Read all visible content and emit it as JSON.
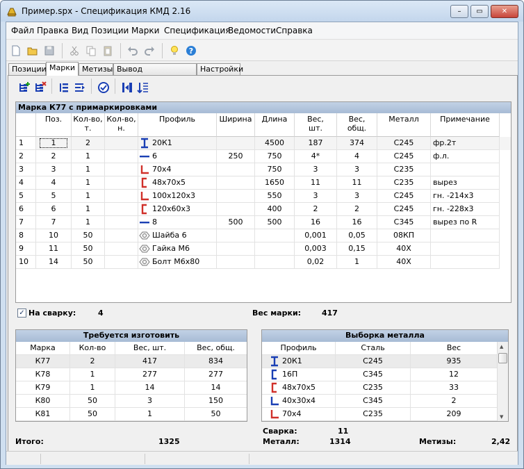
{
  "window": {
    "title": "Пример.spx - Спецификация КМД 2.16",
    "min": "–",
    "max": "▭",
    "close": "✕"
  },
  "menu": [
    "Файл",
    "Правка",
    "Вид",
    "Позиции",
    "Марки",
    "Спецификация",
    "Ведомости",
    "Справка"
  ],
  "tabs": [
    "Позиции",
    "Марки",
    "Метизы",
    "Вывод спецификации",
    "Настройки"
  ],
  "main_grid": {
    "caption": "Марка К77 с примаркировками",
    "headers": [
      "Поз.",
      "Кол-во,\nт.",
      "Кол-во,\nн.",
      "Профиль",
      "Ширина",
      "Длина",
      "Вес,\nшт.",
      "Вес,\nобщ.",
      "Металл",
      "Примечание"
    ],
    "rows": [
      {
        "n": "1",
        "pos": "1",
        "qt": "2",
        "qn": "",
        "prof": "20К1",
        "icon": "i-beam",
        "w": "",
        "len": "4500",
        "ws": "187",
        "wt": "374",
        "met": "С245",
        "note": "фр.2т"
      },
      {
        "n": "2",
        "pos": "2",
        "qt": "1",
        "qn": "",
        "prof": "6",
        "icon": "plate",
        "w": "250",
        "len": "750",
        "ws": "4*",
        "wt": "4",
        "met": "С245",
        "note": "ф.л."
      },
      {
        "n": "3",
        "pos": "3",
        "qt": "1",
        "qn": "",
        "prof": "70х4",
        "icon": "angle",
        "w": "",
        "len": "750",
        "ws": "3",
        "wt": "3",
        "met": "С235",
        "note": ""
      },
      {
        "n": "4",
        "pos": "4",
        "qt": "1",
        "qn": "",
        "prof": "48х70х5",
        "icon": "channel",
        "w": "",
        "len": "1650",
        "ws": "11",
        "wt": "11",
        "met": "С235",
        "note": "вырез"
      },
      {
        "n": "5",
        "pos": "5",
        "qt": "1",
        "qn": "",
        "prof": "100х120х3",
        "icon": "angle",
        "w": "",
        "len": "550",
        "ws": "3",
        "wt": "3",
        "met": "С245",
        "note": "гн. -214х3"
      },
      {
        "n": "6",
        "pos": "6",
        "qt": "1",
        "qn": "",
        "prof": "120х60х3",
        "icon": "channel",
        "w": "",
        "len": "400",
        "ws": "2",
        "wt": "2",
        "met": "С245",
        "note": "гн. -228х3"
      },
      {
        "n": "7",
        "pos": "7",
        "qt": "1",
        "qn": "",
        "prof": "8",
        "icon": "plate",
        "w": "500",
        "len": "500",
        "ws": "16",
        "wt": "16",
        "met": "С345",
        "note": "вырез по R"
      },
      {
        "n": "8",
        "pos": "10",
        "qt": "50",
        "qn": "",
        "prof": "Шайба 6",
        "icon": "hardware",
        "w": "",
        "len": "",
        "ws": "0,001",
        "wt": "0,05",
        "met": "08КП",
        "note": ""
      },
      {
        "n": "9",
        "pos": "11",
        "qt": "50",
        "qn": "",
        "prof": "Гайка М6",
        "icon": "hardware",
        "w": "",
        "len": "",
        "ws": "0,003",
        "wt": "0,15",
        "met": "40Х",
        "note": ""
      },
      {
        "n": "10",
        "pos": "14",
        "qt": "50",
        "qn": "",
        "prof": "Болт М6х80",
        "icon": "hardware",
        "w": "",
        "len": "",
        "ws": "0,02",
        "wt": "1",
        "met": "40Х",
        "note": ""
      }
    ]
  },
  "info": {
    "check": "✓",
    "weld_label": "На сварку:",
    "weld_value": "4",
    "mass_label": "Вес марки:",
    "mass_value": "417"
  },
  "make_panel": {
    "caption": "Требуется изготовить",
    "headers": [
      "Марка",
      "Кол-во",
      "Вес, шт.",
      "Вес, общ."
    ],
    "rows": [
      [
        "К77",
        "2",
        "417",
        "834"
      ],
      [
        "К78",
        "1",
        "277",
        "277"
      ],
      [
        "К79",
        "1",
        "14",
        "14"
      ],
      [
        "К80",
        "50",
        "3",
        "150"
      ],
      [
        "К81",
        "50",
        "1",
        "50"
      ]
    ]
  },
  "metal_panel": {
    "caption": "Выборка металла",
    "headers": [
      "Профиль",
      "Сталь",
      "Вес"
    ],
    "rows": [
      {
        "prof": "20К1",
        "icon": "i-beam",
        "steel": "С245",
        "w": "935"
      },
      {
        "prof": "16П",
        "icon": "channel-blue",
        "steel": "С345",
        "w": "12"
      },
      {
        "prof": "48х70х5",
        "icon": "channel",
        "steel": "С235",
        "w": "33"
      },
      {
        "prof": "40х30х4",
        "icon": "angle-blue",
        "steel": "С345",
        "w": "2"
      },
      {
        "prof": "70х4",
        "icon": "angle",
        "steel": "С235",
        "w": "209"
      }
    ]
  },
  "footer": {
    "total_label": "Итого:",
    "total_value": "1325",
    "weld_label": "Сварка:",
    "weld_value": "11",
    "metal_label": "Металл:",
    "metal_value": "1314",
    "hw_label": "Метизы:",
    "hw_value": "2,42"
  },
  "colors": {
    "accent": "#1a3fb4",
    "profile_red": "#d0302a",
    "caption_bg": "#b5c7de"
  }
}
